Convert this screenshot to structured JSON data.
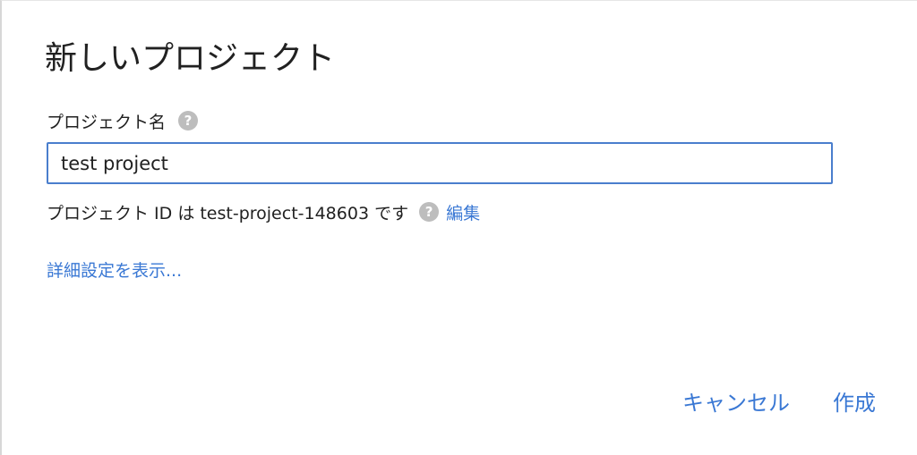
{
  "dialog": {
    "title": "新しいプロジェクト"
  },
  "project_name": {
    "label": "プロジェクト名",
    "value": "test project"
  },
  "project_id": {
    "text": "プロジェクト ID は test-project-148603 です",
    "edit_label": "編集"
  },
  "advanced": {
    "label": "詳細設定を表示..."
  },
  "actions": {
    "cancel_label": "キャンセル",
    "create_label": "作成"
  },
  "help_icon_glyph": "?",
  "colors": {
    "accent": "#3a78d4",
    "input_border": "#4a7ecd",
    "help_icon": "#bdbdbd"
  }
}
